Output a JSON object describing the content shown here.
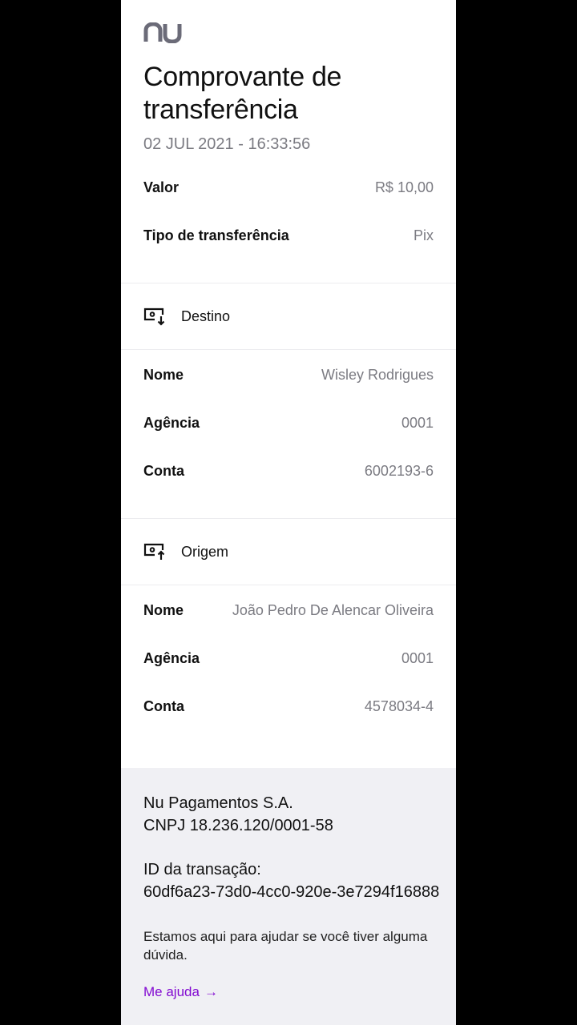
{
  "brand": {
    "logo_text": "nu",
    "color": "#6b6b78",
    "accent": "#820ad1"
  },
  "header": {
    "title": "Comprovante de transferência",
    "datetime": "02 JUL 2021 - 16:33:56"
  },
  "summary": [
    {
      "label": "Valor",
      "value": "R$ 10,00"
    },
    {
      "label": "Tipo de transferência",
      "value": "Pix"
    }
  ],
  "destino": {
    "title": "Destino",
    "icon": "money-in-icon",
    "rows": [
      {
        "label": "Nome",
        "value": "Wisley Rodrigues"
      },
      {
        "label": "Agência",
        "value": "0001"
      },
      {
        "label": "Conta",
        "value": "6002193-6"
      }
    ]
  },
  "origem": {
    "title": "Origem",
    "icon": "money-out-icon",
    "rows": [
      {
        "label": "Nome",
        "value": "João Pedro De Alencar Oliveira"
      },
      {
        "label": "Agência",
        "value": "0001"
      },
      {
        "label": "Conta",
        "value": "4578034-4"
      }
    ]
  },
  "footer": {
    "company": "Nu Pagamentos S.A.",
    "cnpj": "CNPJ 18.236.120/0001-58",
    "id_label": "ID da transação:",
    "id_value": "60df6a23-73d0-4cc0-920e-3e7294f16888",
    "help_text": "Estamos aqui para ajudar se você tiver alguma dúvida.",
    "link_label": "Me ajuda",
    "link_arrow": "→"
  }
}
